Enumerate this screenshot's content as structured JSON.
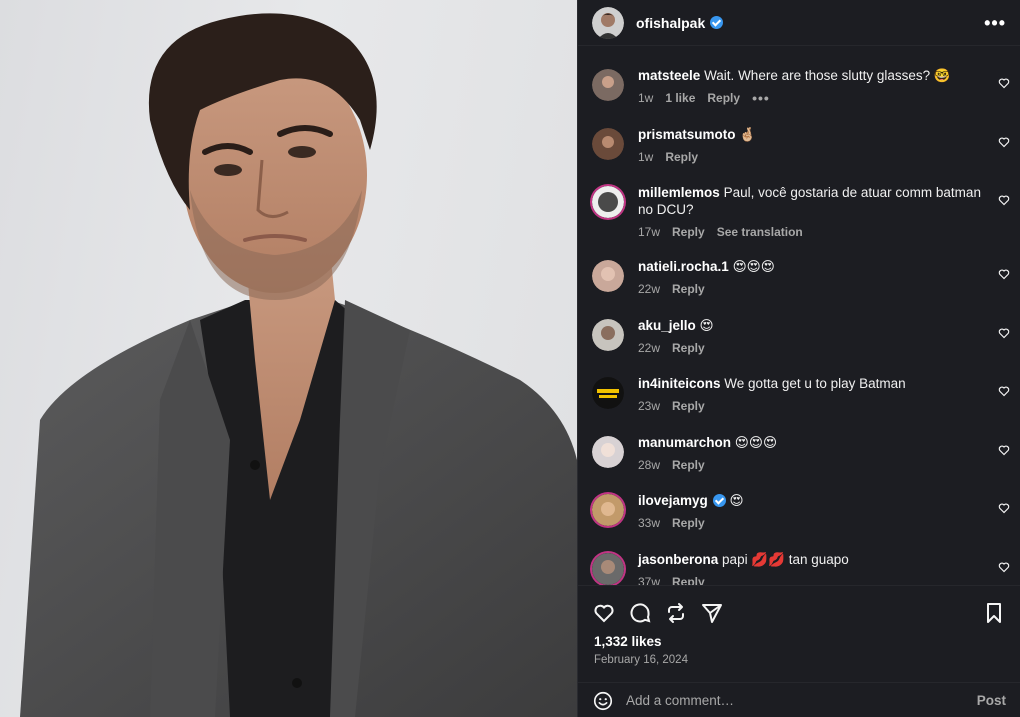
{
  "post": {
    "username": "ofishalpak",
    "more_label": "•••",
    "likes_text": "1,332 likes",
    "date_text": "February 16, 2024",
    "add_comment_placeholder": "Add a comment…",
    "post_label": "Post"
  },
  "comments": [
    {
      "user": "matsteele",
      "text": "Wait. Where are those slutty glasses? 🤓",
      "time": "1w",
      "likes": "1 like",
      "reply": "Reply",
      "extra": "•••",
      "color": "#7b6a62"
    },
    {
      "user": "prismatsumoto",
      "text": "🤞🏼",
      "time": "1w",
      "likes": "",
      "reply": "Reply",
      "extra": "",
      "color": "#6a4a3a"
    },
    {
      "user": "millemlemos",
      "text": "Paul, você gostaria de atuar comm batman no DCU?",
      "time": "17w",
      "likes": "",
      "reply": "Reply",
      "extra": "See translation",
      "color": "#4a4a4a"
    },
    {
      "user": "natieli.rocha.1",
      "text": "😍😍😍",
      "time": "22w",
      "likes": "",
      "reply": "Reply",
      "extra": "",
      "color": "#c9a89a"
    },
    {
      "user": "aku_jello",
      "text": "😍",
      "time": "22w",
      "likes": "",
      "reply": "Reply",
      "extra": "",
      "color": "#c7c4be"
    },
    {
      "user": "in4initeicons",
      "text": "We gotta get u to play Batman",
      "time": "23w",
      "likes": "",
      "reply": "Reply",
      "extra": "",
      "color": "#111111"
    },
    {
      "user": "manumarchon",
      "text": "😍😍😍",
      "time": "28w",
      "likes": "",
      "reply": "Reply",
      "extra": "",
      "color": "#d8d2d4"
    },
    {
      "user": "ilovejamyg",
      "text": "😍",
      "time": "33w",
      "likes": "",
      "reply": "Reply",
      "extra": "",
      "color": "#c29a6a"
    },
    {
      "user": "jasonberona",
      "text": "papi 💋💋 tan guapo",
      "time": "37w",
      "likes": "",
      "reply": "Reply",
      "extra": "",
      "color": "#6a6a6a"
    }
  ],
  "colors": {
    "panel_bg": "#1c1d22",
    "verified": "#3897f0",
    "secondary_text": "#a8a8a8"
  },
  "icons": [
    "heart-icon",
    "comment-icon",
    "repost-icon",
    "share-icon",
    "bookmark-icon",
    "emoji-icon",
    "verified-icon"
  ]
}
